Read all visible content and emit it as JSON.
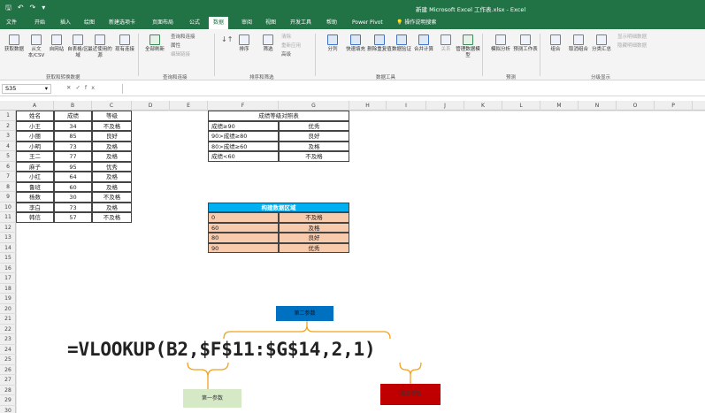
{
  "window": {
    "title": "新建 Microsoft Excel 工作表.xlsx - Excel",
    "qat": [
      "🖫",
      "↶",
      "↷",
      "▾"
    ]
  },
  "tabs": [
    "文件",
    "开始",
    "插入",
    "绘图",
    "新建选项卡",
    "页面布局",
    "公式",
    "数据",
    "审阅",
    "视图",
    "开发工具",
    "帮助",
    "Power Pivot",
    "💡 操作说明搜索"
  ],
  "ribbon": {
    "get_data": {
      "buttons": [
        "获取数据",
        "从文本/CSV",
        "自网站",
        "自表格/区域",
        "最近使用的源",
        "现有连接"
      ],
      "group": "获取和转换数据"
    },
    "queries": {
      "refresh": "全部刷新",
      "small": [
        "查询和连接",
        "属性",
        "编辑链接"
      ],
      "group": "查询和连接"
    },
    "sort": {
      "buttons": [
        "排序",
        "筛选"
      ],
      "small": [
        "清除",
        "重新应用",
        "高级"
      ],
      "group": "排序和筛选"
    },
    "tools": {
      "buttons": [
        "分列",
        "快速填充",
        "删除重复值",
        "数据验证",
        "合并计算",
        "关系",
        "管理数据模型"
      ],
      "group": "数据工具"
    },
    "forecast": {
      "buttons": [
        "模拟分析",
        "预测工作表"
      ],
      "group": "预测"
    },
    "outline": {
      "buttons": [
        "组合",
        "取消组合",
        "分类汇总"
      ],
      "small": [
        "显示明细数据",
        "隐藏明细数据"
      ],
      "group": "分级显示"
    }
  },
  "formula_bar": {
    "name_box": "S35",
    "icons": [
      "✕",
      "✓",
      "fx"
    ],
    "value": ""
  },
  "columns": [
    "A",
    "B",
    "C",
    "D",
    "E",
    "F",
    "G",
    "H",
    "I",
    "J",
    "K",
    "L",
    "M",
    "N",
    "O",
    "P"
  ],
  "rows": [
    "1",
    "2",
    "3",
    "4",
    "5",
    "6",
    "7",
    "8",
    "9",
    "10",
    "11",
    "12",
    "13",
    "14",
    "15",
    "16",
    "17",
    "18",
    "19",
    "20",
    "21",
    "22",
    "23",
    "24",
    "25",
    "26",
    "27",
    "28",
    "29",
    "30"
  ],
  "scores": {
    "headers": [
      "姓名",
      "成绩",
      "等级"
    ],
    "rows": [
      [
        "小王",
        "34",
        "不及格"
      ],
      [
        "小丽",
        "85",
        "良好"
      ],
      [
        "小明",
        "73",
        "及格"
      ],
      [
        "王二",
        "77",
        "及格"
      ],
      [
        "麻子",
        "95",
        "优秀"
      ],
      [
        "小红",
        "64",
        "及格"
      ],
      [
        "鲁班",
        "60",
        "及格"
      ],
      [
        "杨数",
        "30",
        "不及格"
      ],
      [
        "李白",
        "73",
        "及格"
      ],
      [
        "韩信",
        "57",
        "不及格"
      ]
    ]
  },
  "lookup_table": {
    "title": "成绩等级对照表",
    "rows": [
      [
        "成绩≥90",
        "优秀"
      ],
      [
        "90>成绩≥80",
        "良好"
      ],
      [
        "80>成绩≥60",
        "及格"
      ],
      [
        "成绩<60",
        "不及格"
      ]
    ]
  },
  "data_area": {
    "title": "构建数据区域",
    "rows": [
      [
        "0",
        "不及格"
      ],
      [
        "60",
        "及格"
      ],
      [
        "80",
        "良好"
      ],
      [
        "90",
        "优秀"
      ]
    ]
  },
  "formula_text": "=VLOOKUP(B2,$F$11:$G$14,2,1)",
  "callouts": {
    "first": "第一参数",
    "second": "第二参数",
    "third": "第三参数"
  },
  "colors": {
    "excel_green": "#217346",
    "blue_header": "#00b0f0",
    "orange_cell": "#f8cbad",
    "callout_blue": "#0070c0",
    "callout_green": "#d6e9c6",
    "callout_red": "#c00000",
    "bracket": "#f0a21c"
  }
}
